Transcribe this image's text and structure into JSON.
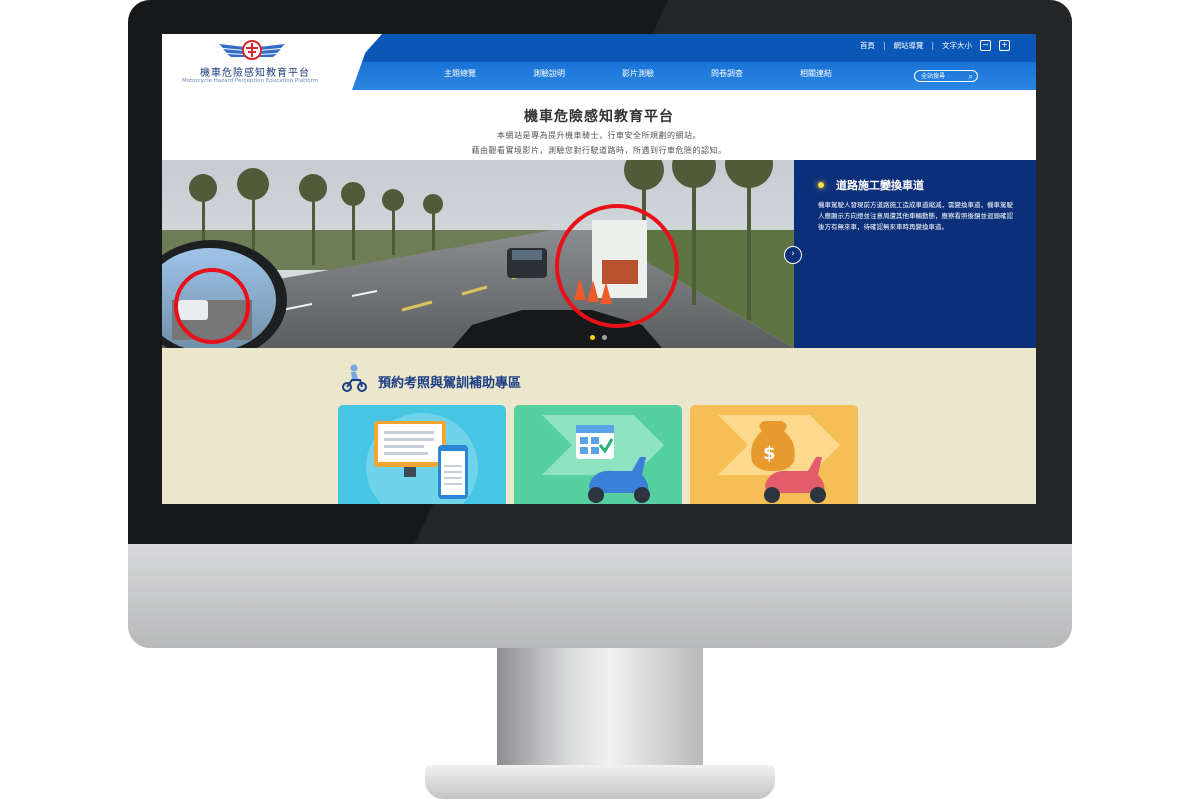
{
  "site": {
    "logo_title": "機車危險感知教育平台",
    "logo_subtitle": "Motorcycle Hazard Perception Education Platform"
  },
  "top_links": {
    "home": "首頁",
    "sitemap": "網站導覽",
    "font_size": "文字大小",
    "decrease": "−",
    "increase": "+"
  },
  "nav": {
    "items": [
      "主題總覽",
      "測驗說明",
      "影片測驗",
      "問卷調查",
      "相關連結"
    ]
  },
  "search": {
    "label": "全站搜尋"
  },
  "intro": {
    "title": "機車危險感知教育平台",
    "line1": "本網站是專為提升機車騎士，行車安全所規劃的網站。",
    "line2": "藉由觀看實境影片，測驗您對行駛道路時，所遇到行車危險的認知。"
  },
  "hero": {
    "slide_title": "道路施工變換車道",
    "slide_text": "機車駕駛人發現前方道路施工造成車道縮減，需變換車道，機車駕駛人應顯示方向燈並注意周遭其他車輛動態，應察看照後鏡並迴頭確認後方有無來車，待確認無來車時再變換車道。",
    "slide_count": 2,
    "active_slide": 1
  },
  "booking": {
    "title": "預約考照與駕訓補助專區"
  },
  "colors": {
    "header_blue": "#0b57b8",
    "panel_navy": "#0c2f7a",
    "booking_bg": "#ebe6cc",
    "card_cyan": "#46c6e3",
    "card_green": "#56d0a0",
    "card_orange": "#f5bf55",
    "highlight_red": "#e8111a"
  }
}
